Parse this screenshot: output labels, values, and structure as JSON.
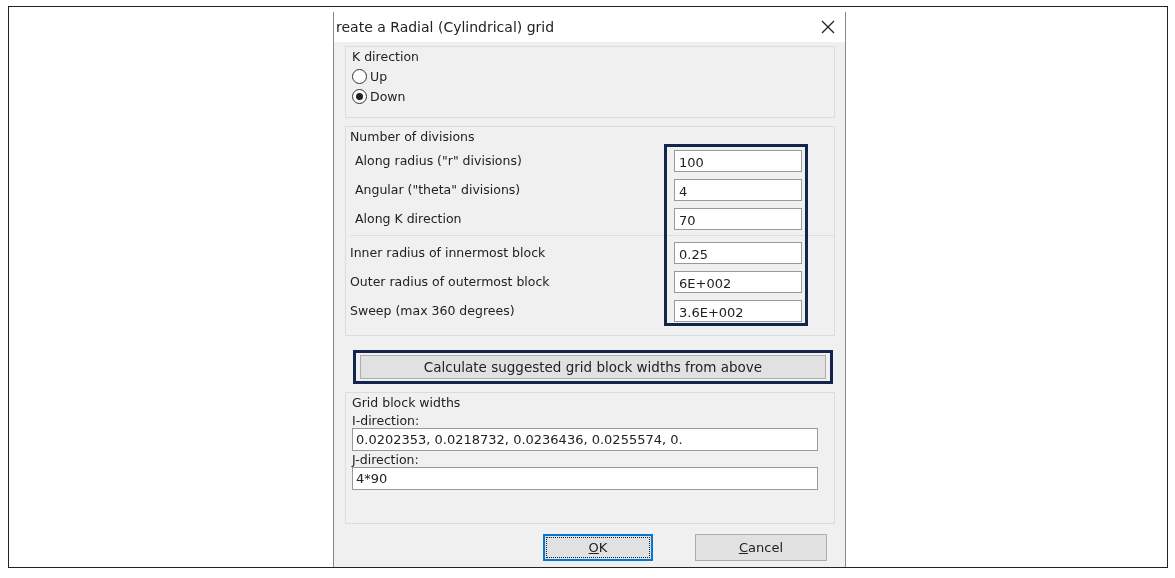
{
  "window": {
    "title": "reate a Radial (Cylindrical) grid"
  },
  "k_direction": {
    "title": "K direction",
    "options": [
      {
        "label": "Up",
        "selected": false
      },
      {
        "label": "Down",
        "selected": true
      }
    ]
  },
  "divisions": {
    "title": "Number of divisions",
    "fields": [
      {
        "label": "Along radius (\"r\" divisions)",
        "value": "100"
      },
      {
        "label": "Angular (\"theta\" divisions)",
        "value": "4"
      },
      {
        "label": "Along K direction",
        "value": "70"
      }
    ],
    "geometry": [
      {
        "label": "Inner radius of innermost block",
        "value": "0.25"
      },
      {
        "label": "Outer radius of outermost block",
        "value": "6E+002"
      },
      {
        "label": "Sweep (max 360 degrees)",
        "value": "3.6E+002"
      }
    ]
  },
  "calculate_button": "Calculate suggested grid block widths from above",
  "widths": {
    "title": "Grid block widths",
    "fields": [
      {
        "label": "I-direction:",
        "value": "0.0202353, 0.0218732, 0.0236436, 0.0255574, 0."
      },
      {
        "label": "J-direction:",
        "value": "4*90"
      }
    ]
  },
  "buttons": [
    {
      "label": "OK",
      "default": true
    },
    {
      "label": "Cancel",
      "default": false
    }
  ]
}
